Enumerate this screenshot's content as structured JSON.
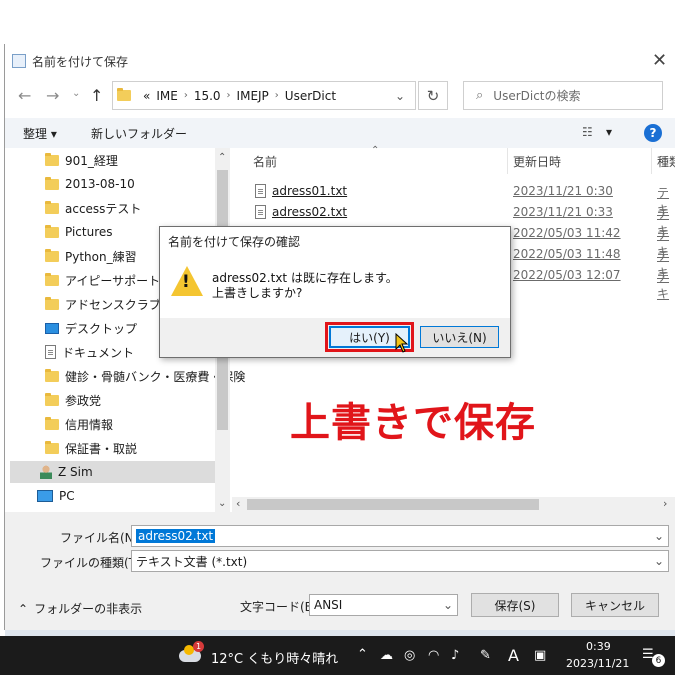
{
  "dialog_window": {
    "title": "名前を付けて保存",
    "address_prefix": "«",
    "breadcrumb": [
      "IME",
      "15.0",
      "IMEJP",
      "UserDict"
    ],
    "search_placeholder": "UserDictの検索"
  },
  "toolbar": {
    "organize_label": "整理 ▾",
    "new_folder_label": "新しいフォルダー",
    "view_label": "▾"
  },
  "nav_pane": {
    "items": [
      {
        "label": "901_経理",
        "icon": "folder-icon"
      },
      {
        "label": "2013-08-10",
        "icon": "folder-icon"
      },
      {
        "label": "accessテスト",
        "icon": "folder-icon"
      },
      {
        "label": "Pictures",
        "icon": "folder-icon"
      },
      {
        "label": "Python_練習",
        "icon": "folder-icon"
      },
      {
        "label": "アイピーサポート",
        "icon": "folder-icon"
      },
      {
        "label": "アドセンスクラブ",
        "icon": "folder-icon"
      },
      {
        "label": "デスクトップ",
        "icon": "desktop-icon"
      },
      {
        "label": "ドキュメント",
        "icon": "documents-icon"
      },
      {
        "label": "健診・骨髄バンク・医療費・保険",
        "icon": "folder-icon"
      },
      {
        "label": "参政党",
        "icon": "folder-icon"
      },
      {
        "label": "信用情報",
        "icon": "folder-icon"
      },
      {
        "label": "保証書・取説",
        "icon": "folder-icon"
      },
      {
        "label": "Z Sim",
        "icon": "user-icon"
      },
      {
        "label": "PC",
        "icon": "pc-icon"
      }
    ]
  },
  "file_list": {
    "columns": [
      "名前",
      "更新日時",
      "種類"
    ],
    "rows": [
      {
        "name": "adress01.txt",
        "date": "2023/11/21 0:30",
        "type": "テキ"
      },
      {
        "name": "adress02.txt",
        "date": "2023/11/21 0:33",
        "type": "テキ"
      },
      {
        "name": "",
        "date": "2022/05/03 11:42",
        "type": "テキ"
      },
      {
        "name": "",
        "date": "2022/05/03 11:48",
        "type": "テキ"
      },
      {
        "name": "",
        "date": "2022/05/03 12:07",
        "type": "テキ"
      }
    ]
  },
  "footer": {
    "filename_label": "ファイル名(N):",
    "filename_value": "adress02.txt",
    "filetype_label": "ファイルの種類(T):",
    "filetype_value": "テキスト文書 (*.txt)",
    "hide_folders_label": "フォルダーの非表示",
    "encoding_label": "文字コード(E):",
    "encoding_value": "ANSI",
    "save_label": "保存(S)",
    "cancel_label": "キャンセル"
  },
  "confirm_dialog": {
    "title": "名前を付けて保存の確認",
    "message_line1": "adress02.txt は既に存在します。",
    "message_line2": "上書きしますか?",
    "yes_label": "はい(Y)",
    "no_label": "いいえ(N)"
  },
  "annotation": {
    "caption": "上書きで保存",
    "color": "#e1151a"
  },
  "taskbar": {
    "weather_badge": "1",
    "weather": "12°C くもり時々晴れ",
    "ime_mode": "A",
    "time": "0:39",
    "date": "2023/11/21",
    "notification_count": "6"
  }
}
